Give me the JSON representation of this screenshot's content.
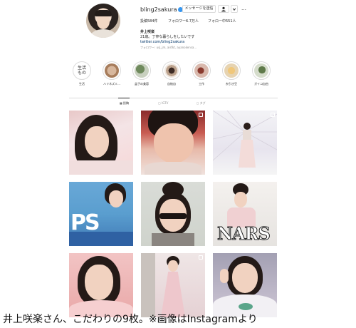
{
  "profile": {
    "username": "bling2sakura",
    "message_button": "メッセージを送信",
    "more": "…",
    "stats": {
      "posts": "投稿584件",
      "followers": "フォロワー6.7万人",
      "following": "フォロー中551人"
    },
    "full_name": "井上咲楽",
    "bio": "21歳。丁寧な暮らしをしたいです",
    "link": "twitter.com/bling2sakura",
    "followed_by": "フォロワー: usj_jm, aisfkt, ayanokensa..."
  },
  "highlights": [
    {
      "label": "生活",
      "pic_text": "生活\nもの"
    },
    {
      "label": "ハリネズミ..."
    },
    {
      "label": "盆子の美容"
    },
    {
      "label": "自給自"
    },
    {
      "label": "工作"
    },
    {
      "label": "糸引き豆"
    },
    {
      "label": "ガイコ自由"
    }
  ],
  "tabs": {
    "posts": "▦ 投稿",
    "igtv": "▢ IGTV",
    "tagged": "◻ タグ"
  },
  "grid_labels": {
    "nars": "NARS",
    "ps": "PS"
  },
  "caption": "井上咲楽さん、こだわりの9枚。※画像はInstagramより",
  "colors": {
    "accent": "#3897f0",
    "border": "#dbdbdb",
    "text": "#262626",
    "muted": "#8e8e8e"
  }
}
